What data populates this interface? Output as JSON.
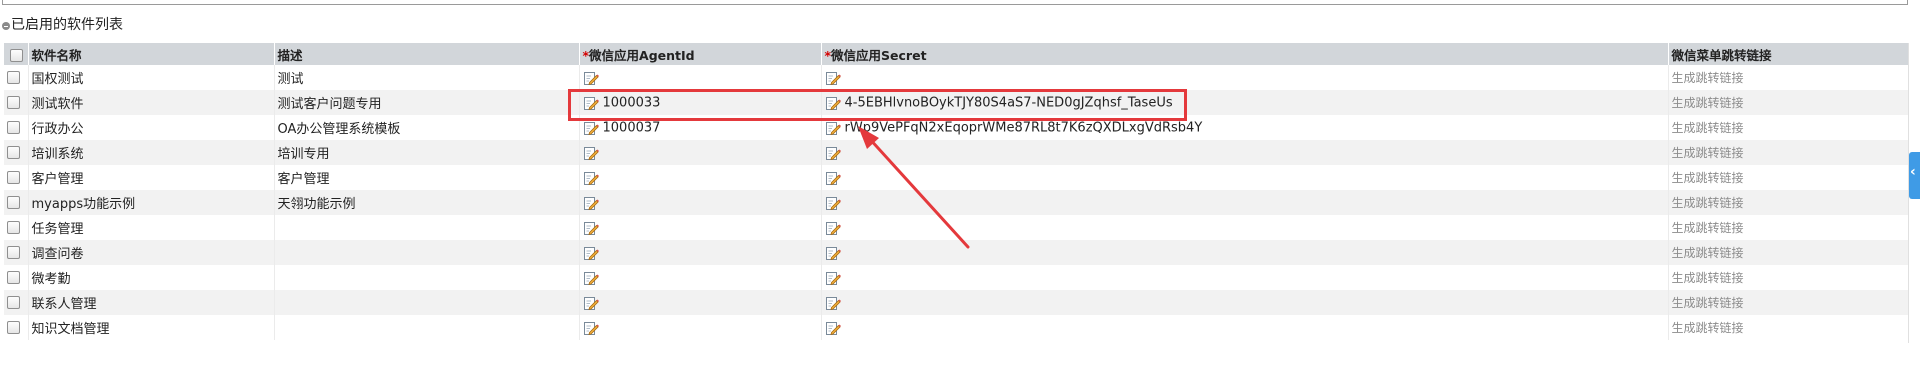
{
  "section": {
    "title": "已启用的软件列表"
  },
  "table": {
    "headers": {
      "name": "软件名称",
      "description": "描述",
      "agent_id": "微信应用AgentId",
      "secret": "微信应用Secret",
      "link": "微信菜单跳转链接"
    },
    "required_mark": "*",
    "rows": [
      {
        "name": "国权测试",
        "description": "测试",
        "agent_id": "",
        "secret": "",
        "link": "生成跳转链接"
      },
      {
        "name": "测试软件",
        "description": "测试客户问题专用",
        "agent_id": "1000033",
        "secret": "4-5EBHlvnoBOykTJY80S4aS7-NED0gJZqhsf_TaseUs",
        "link": "生成跳转链接"
      },
      {
        "name": "行政办公",
        "description": "OA办公管理系统模板",
        "agent_id": "1000037",
        "secret": "rWp9VePFqN2xEqoprWMe87RL8t7K6zQXDLxgVdRsb4Y",
        "link": "生成跳转链接"
      },
      {
        "name": "培训系统",
        "description": "培训专用",
        "agent_id": "",
        "secret": "",
        "link": "生成跳转链接"
      },
      {
        "name": "客户管理",
        "description": "客户管理",
        "agent_id": "",
        "secret": "",
        "link": "生成跳转链接"
      },
      {
        "name": "myapps功能示例",
        "description": "天翎功能示例",
        "agent_id": "",
        "secret": "",
        "link": "生成跳转链接"
      },
      {
        "name": "任务管理",
        "description": "",
        "agent_id": "",
        "secret": "",
        "link": "生成跳转链接"
      },
      {
        "name": "调查问卷",
        "description": "",
        "agent_id": "",
        "secret": "",
        "link": "生成跳转链接"
      },
      {
        "name": "微考勤",
        "description": "",
        "agent_id": "",
        "secret": "",
        "link": "生成跳转链接"
      },
      {
        "name": "联系人管理",
        "description": "",
        "agent_id": "",
        "secret": "",
        "link": "生成跳转链接"
      },
      {
        "name": "知识文档管理",
        "description": "",
        "agent_id": "",
        "secret": "",
        "link": "生成跳转链接"
      }
    ]
  },
  "icons": {
    "edit": "edit-pencil-icon",
    "collapse": "collapse-minus-icon",
    "side_tab": "chevron-left-icon"
  },
  "colors": {
    "annotation_red": "#e4393c",
    "header_bg": "#d2d6da",
    "side_tab": "#3f9be6",
    "link_gray": "#8c8c8c"
  }
}
